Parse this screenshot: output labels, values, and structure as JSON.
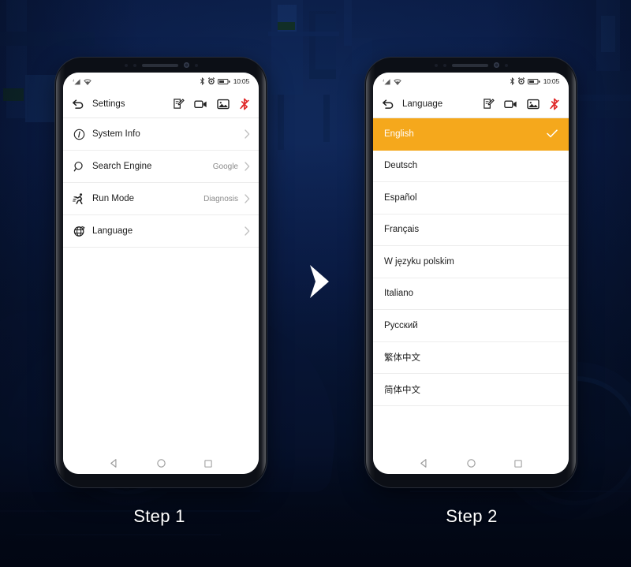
{
  "background": {
    "base_color": "#0b1c3f",
    "scene": "dark navy automotive workshop with car silhouette"
  },
  "accent_color": "#f5a81c",
  "bluetooth_off_color": "#e02b2b",
  "status_bar": {
    "signal_icon": "signal-bars-icon",
    "wifi_icon": "wifi-icon",
    "bluetooth_icon": "bluetooth-icon",
    "alarm_icon": "alarm-icon",
    "battery_icon": "battery-icon",
    "time": "10:05"
  },
  "toolbar_icons": [
    {
      "name": "note-edit-icon",
      "label": "Note"
    },
    {
      "name": "video-record-icon",
      "label": "Record video"
    },
    {
      "name": "screenshot-icon",
      "label": "Screenshot"
    },
    {
      "name": "bluetooth-disconnected-icon",
      "label": "Bluetooth disconnected"
    }
  ],
  "navbar": {
    "back": "back-triangle-icon",
    "home": "home-circle-icon",
    "recents": "recents-square-icon"
  },
  "step1": {
    "caption": "Step 1",
    "appbar": {
      "back_icon": "back-arrow-icon",
      "title": "Settings"
    },
    "rows": [
      {
        "icon": "info-circle-icon",
        "label": "System Info",
        "value": ""
      },
      {
        "icon": "search-icon",
        "label": "Search Engine",
        "value": "Google"
      },
      {
        "icon": "running-man-icon",
        "label": "Run Mode",
        "value": "Diagnosis"
      },
      {
        "icon": "globe-icon",
        "label": "Language",
        "value": ""
      }
    ]
  },
  "step2": {
    "caption": "Step 2",
    "appbar": {
      "back_icon": "back-arrow-icon",
      "title": "Language"
    },
    "languages": [
      {
        "label": "English",
        "selected": true
      },
      {
        "label": "Deutsch",
        "selected": false
      },
      {
        "label": "Español",
        "selected": false
      },
      {
        "label": "Français",
        "selected": false
      },
      {
        "label": "W języku polskim",
        "selected": false
      },
      {
        "label": "Italiano",
        "selected": false
      },
      {
        "label": "Русский",
        "selected": false
      },
      {
        "label": "繁体中文",
        "selected": false
      },
      {
        "label": "简体中文",
        "selected": false
      }
    ]
  },
  "flow_arrow": "chevron-right-icon"
}
